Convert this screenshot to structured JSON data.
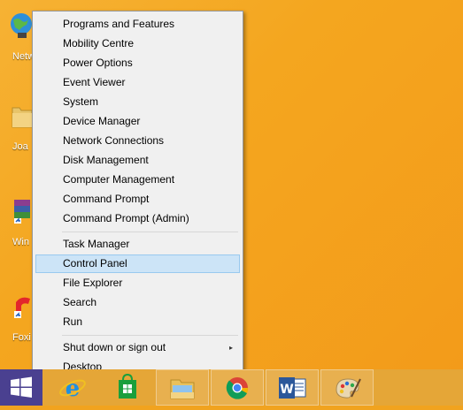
{
  "desktop": {
    "icons": [
      {
        "label": "Netw",
        "icon": "network-globe-icon"
      },
      {
        "label": "Joa",
        "icon": "user-folder-icon"
      },
      {
        "label": "Win",
        "icon": "winrar-shortcut-icon"
      },
      {
        "label": "Foxi",
        "icon": "foxit-shortcut-icon"
      }
    ]
  },
  "menu": {
    "group1": [
      {
        "label": "Programs and Features"
      },
      {
        "label": "Mobility Centre"
      },
      {
        "label": "Power Options"
      },
      {
        "label": "Event Viewer"
      },
      {
        "label": "System"
      },
      {
        "label": "Device Manager"
      },
      {
        "label": "Network Connections"
      },
      {
        "label": "Disk Management"
      },
      {
        "label": "Computer Management"
      },
      {
        "label": "Command Prompt"
      },
      {
        "label": "Command Prompt (Admin)"
      }
    ],
    "group2": [
      {
        "label": "Task Manager"
      },
      {
        "label": "Control Panel",
        "highlighted": true
      },
      {
        "label": "File Explorer"
      },
      {
        "label": "Search"
      },
      {
        "label": "Run"
      }
    ],
    "group3": [
      {
        "label": "Shut down or sign out",
        "submenu": "▸"
      },
      {
        "label": "Desktop"
      }
    ]
  },
  "taskbar": {
    "apps": [
      {
        "icon": "windows-start-icon"
      },
      {
        "icon": "internet-explorer-icon"
      },
      {
        "icon": "windows-store-icon"
      },
      {
        "icon": "file-explorer-icon"
      },
      {
        "icon": "chrome-icon"
      },
      {
        "icon": "word-icon"
      },
      {
        "icon": "paint-icon"
      }
    ]
  },
  "colors": {
    "desktop": "#f4a61f",
    "taskbar": "#e5a637",
    "highlight": "#cce4f7",
    "start_button": "#4a4090"
  }
}
